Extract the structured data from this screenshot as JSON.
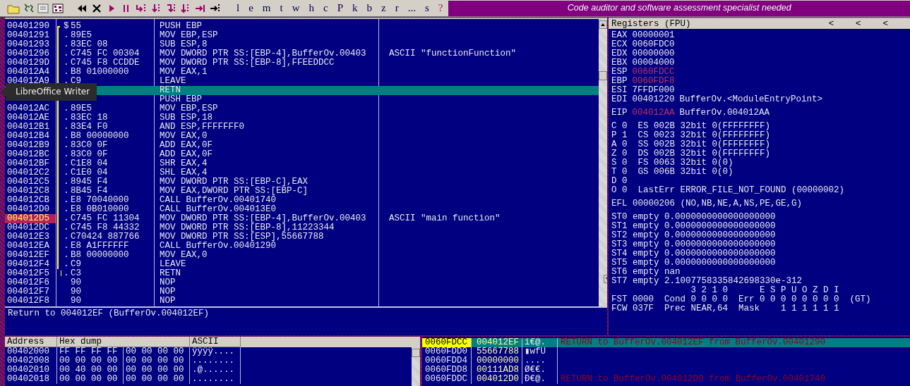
{
  "toolbar": {
    "letters": [
      {
        "label": "l",
        "kind": "letter"
      },
      {
        "label": "e",
        "kind": "letter"
      },
      {
        "label": "m",
        "kind": "letter"
      },
      {
        "label": "t",
        "kind": "letter"
      },
      {
        "label": "w",
        "kind": "letter"
      },
      {
        "label": "h",
        "kind": "letter"
      },
      {
        "label": "c",
        "kind": "letter"
      },
      {
        "label": "P",
        "kind": "letter"
      },
      {
        "label": "k",
        "kind": "letter"
      },
      {
        "label": "b",
        "kind": "letter"
      },
      {
        "label": "z",
        "kind": "letter"
      },
      {
        "label": "r",
        "kind": "letter"
      },
      {
        "label": "...",
        "kind": "letter"
      },
      {
        "label": "s",
        "kind": "letter"
      },
      {
        "label": "?",
        "kind": "help"
      }
    ],
    "banner": "Code auditor and software assessment specialist needed"
  },
  "disassembly": {
    "rows": [
      {
        "address": "00401290",
        "mark": "$",
        "hex": "55",
        "instruction": "PUSH EBP",
        "in_loop": true,
        "selected": false,
        "breakpoint": false
      },
      {
        "address": "00401291",
        "mark": ".",
        "hex": "89E5",
        "instruction": "MOV EBP,ESP",
        "in_loop": true,
        "selected": false,
        "breakpoint": false
      },
      {
        "address": "00401293",
        "mark": ".",
        "hex": "83EC 08",
        "instruction": "SUB ESP,8",
        "in_loop": true,
        "selected": false,
        "breakpoint": false
      },
      {
        "address": "00401296",
        "mark": ".",
        "hex": "C745 FC 00304",
        "instruction": "MOV DWORD PTR SS:[EBP-4],BufferOv.00403",
        "comment": "ASCII \"functionFunction\"",
        "in_loop": true,
        "selected": false,
        "breakpoint": false
      },
      {
        "address": "0040129D",
        "mark": ".",
        "hex": "C745 F8 CCDDE",
        "instruction": "MOV DWORD PTR SS:[EBP-8],FFEEDDCC",
        "in_loop": true,
        "selected": false,
        "breakpoint": false
      },
      {
        "address": "004012A4",
        "mark": ".",
        "hex": "B8 01000000",
        "instruction": "MOV EAX,1",
        "in_loop": true,
        "selected": false,
        "breakpoint": false
      },
      {
        "address": "004012A9",
        "mark": ".",
        "hex": "C9",
        "instruction": "LEAVE",
        "in_loop": true,
        "selected": false,
        "breakpoint": false
      },
      {
        "instruction": "RETN",
        "in_loop": true,
        "selected": true
      },
      {
        "instruction": "PUSH EBP",
        "in_loop": true,
        "selected": false
      },
      {
        "address": "004012AC",
        "mark": ".",
        "hex": "89E5",
        "instruction": "MOV EBP,ESP",
        "in_loop": true,
        "selected": false,
        "breakpoint": false
      },
      {
        "address": "004012AE",
        "mark": ".",
        "hex": "83EC 18",
        "instruction": "SUB ESP,18",
        "in_loop": true,
        "selected": false,
        "breakpoint": false
      },
      {
        "address": "004012B1",
        "mark": ".",
        "hex": "83E4 F0",
        "instruction": "AND ESP,FFFFFFF0",
        "in_loop": true,
        "selected": false,
        "breakpoint": false
      },
      {
        "address": "004012B4",
        "mark": ".",
        "hex": "B8 00000000",
        "instruction": "MOV EAX,0",
        "in_loop": true,
        "selected": false,
        "breakpoint": false
      },
      {
        "address": "004012B9",
        "mark": ".",
        "hex": "83C0 0F",
        "instruction": "ADD EAX,0F",
        "in_loop": true,
        "selected": false,
        "breakpoint": false
      },
      {
        "address": "004012BC",
        "mark": ".",
        "hex": "83C0 0F",
        "instruction": "ADD EAX,0F",
        "in_loop": true,
        "selected": false,
        "breakpoint": false
      },
      {
        "address": "004012BF",
        "mark": ".",
        "hex": "C1E8 04",
        "instruction": "SHR EAX,4",
        "in_loop": true,
        "selected": false,
        "breakpoint": false
      },
      {
        "address": "004012C2",
        "mark": ".",
        "hex": "C1E0 04",
        "instruction": "SHL EAX,4",
        "in_loop": true,
        "selected": false,
        "breakpoint": false
      },
      {
        "address": "004012C5",
        "mark": ".",
        "hex": "8945 F4",
        "instruction": "MOV DWORD PTR SS:[EBP-C],EAX",
        "in_loop": true,
        "selected": false,
        "breakpoint": false
      },
      {
        "address": "004012C8",
        "mark": ".",
        "hex": "8B45 F4",
        "instruction": "MOV EAX,DWORD PTR SS:[EBP-C]",
        "in_loop": true,
        "selected": false,
        "breakpoint": false
      },
      {
        "address": "004012CB",
        "mark": ".",
        "hex": "E8 70040000",
        "instruction": "CALL BufferOv.00401740",
        "in_loop": true,
        "selected": false,
        "breakpoint": false
      },
      {
        "address": "004012D0",
        "mark": ".",
        "hex": "E8 0B010000",
        "instruction": "CALL BufferOv.004013E0",
        "in_loop": true,
        "selected": false,
        "breakpoint": false
      },
      {
        "address": "004012D5",
        "mark": ".",
        "hex": "C745 FC 11304",
        "instruction": "MOV DWORD PTR SS:[EBP-4],BufferOv.00403",
        "comment": "ASCII \"main function\"",
        "in_loop": true,
        "selected": false,
        "breakpoint": true
      },
      {
        "address": "004012DC",
        "mark": ".",
        "hex": "C745 F8 44332",
        "instruction": "MOV DWORD PTR SS:[EBP-8],11223344",
        "in_loop": true,
        "selected": false,
        "breakpoint": false
      },
      {
        "address": "004012E3",
        "mark": ".",
        "hex": "C70424 887766",
        "instruction": "MOV DWORD PTR SS:[ESP],55667788",
        "in_loop": true,
        "selected": false,
        "breakpoint": false
      },
      {
        "address": "004012EA",
        "mark": ".",
        "hex": "E8 A1FFFFFF",
        "instruction": "CALL BufferOv.00401290",
        "in_loop": true,
        "selected": false,
        "breakpoint": false
      },
      {
        "address": "004012EF",
        "mark": ".",
        "hex": "B8 00000000",
        "instruction": "MOV EAX,0",
        "in_loop": true,
        "selected": false,
        "breakpoint": false
      },
      {
        "address": "004012F4",
        "mark": ".",
        "hex": "C9",
        "instruction": "LEAVE",
        "in_loop": true,
        "selected": false,
        "breakpoint": false
      },
      {
        "address": "004012F5",
        "mark": ".",
        "hex": "C3",
        "instruction": "RETN",
        "in_loop": true,
        "selected": false,
        "breakpoint": false
      },
      {
        "address": "004012F6",
        "hex": "90",
        "instruction": "NOP",
        "in_loop": false,
        "selected": false,
        "breakpoint": false
      },
      {
        "address": "004012F7",
        "hex": "90",
        "instruction": "NOP",
        "in_loop": false,
        "selected": false,
        "breakpoint": false
      },
      {
        "address": "004012F8",
        "hex": "90",
        "instruction": "NOP",
        "in_loop": false,
        "selected": false,
        "breakpoint": false
      }
    ],
    "info": "Return to 004012EF (BufferOv.004012EF)"
  },
  "registers": {
    "title": "Registers (FPU)",
    "arrows": [
      "<",
      "<",
      "<"
    ],
    "cpu": [
      {
        "name": "EAX",
        "value": "00000001",
        "changed": false
      },
      {
        "name": "ECX",
        "value": "0060FDC0",
        "changed": false
      },
      {
        "name": "EDX",
        "value": "00000000",
        "changed": false
      },
      {
        "name": "EBX",
        "value": "00004000",
        "changed": false
      },
      {
        "name": "ESP",
        "value": "0060FDCC",
        "changed": true
      },
      {
        "name": "EBP",
        "value": "0060FDF8",
        "changed": true
      },
      {
        "name": "ESI",
        "value": "7FFDF000",
        "changed": false
      },
      {
        "name": "EDI",
        "value": "00401220",
        "changed": false,
        "comment": "BufferOv.<ModuleEntryPoint>"
      }
    ],
    "eip": {
      "name": "EIP",
      "value": "004012AA",
      "changed": true,
      "comment": "BufferOv.004012AA"
    },
    "flags": [
      "C 0  ES 002B 32bit 0(FFFFFFFF)",
      "P 1  CS 0023 32bit 0(FFFFFFFF)",
      "A 0  SS 002B 32bit 0(FFFFFFFF)",
      "Z 0  DS 002B 32bit 0(FFFFFFFF)",
      "S 0  FS 0063 32bit 0(0)",
      "T 0  GS 006B 32bit 0(0)",
      "D 0",
      "O 0  LastErr ERROR_FILE_NOT_FOUND (00000002)"
    ],
    "efl": "EFL 00000206 (NO,NB,NE,A,NS,PE,GE,G)",
    "fpu": [
      "ST0 empty 0.0000000000000000000",
      "ST1 empty 0.0000000000000000000",
      "ST2 empty 0.0000000000000000000",
      "ST3 empty 0.0000000000000000000",
      "ST4 empty 0.0000000000000000000",
      "ST5 empty 0.0000000000000000000",
      "ST6 empty nan",
      "ST7 empty 2.1007758335842698330e-312"
    ],
    "fpu_status": [
      "               3 2 1 0      E S P U O Z D I",
      "FST 0000  Cond 0 0 0 0  Err 0 0 0 0 0 0 0 0  (GT)",
      "FCW 037F  Prec NEAR,64  Mask    1 1 1 1 1 1"
    ]
  },
  "dump": {
    "columns": [
      "Address",
      "Hex dump",
      "ASCII"
    ],
    "rows": [
      {
        "address": "00402000",
        "hex_a": "FF FF FF FF",
        "hex_b": "00 00 00 00",
        "ascii": "ÿÿÿÿ...."
      },
      {
        "address": "00402008",
        "hex_a": "00 00 00 00",
        "hex_b": "00 00 00 00",
        "ascii": "........"
      },
      {
        "address": "00402010",
        "hex_a": "00 40 00 00",
        "hex_b": "00 00 00 00",
        "ascii": ".@......"
      },
      {
        "address": "00402018",
        "hex_a": "00 00 00 00",
        "hex_b": "00 00 00 00",
        "ascii": "........"
      }
    ]
  },
  "stack": {
    "rows": [
      {
        "address": "0060FDCC",
        "value": "004012EF",
        "ascii": "i€@.",
        "comment": "RETURN to BufferOv.004012EF from BufferOv.00401290",
        "selected": true
      },
      {
        "address": "0060FDD0",
        "value": "55667788",
        "ascii": "▮wfU",
        "selected": false
      },
      {
        "address": "0060FDD4",
        "value": "00000000",
        "ascii": "....",
        "selected": false
      },
      {
        "address": "0060FDD8",
        "value": "00111AD8",
        "ascii": "Ø€€.",
        "selected": false
      },
      {
        "address": "0060FDDC",
        "value": "004012D0",
        "ascii": "Ð€@.",
        "comment": "RETURN to BufferOv.004012D0 from BufferOv.00401740",
        "selected": false
      }
    ]
  },
  "tooltip": "LibreOffice Writer"
}
